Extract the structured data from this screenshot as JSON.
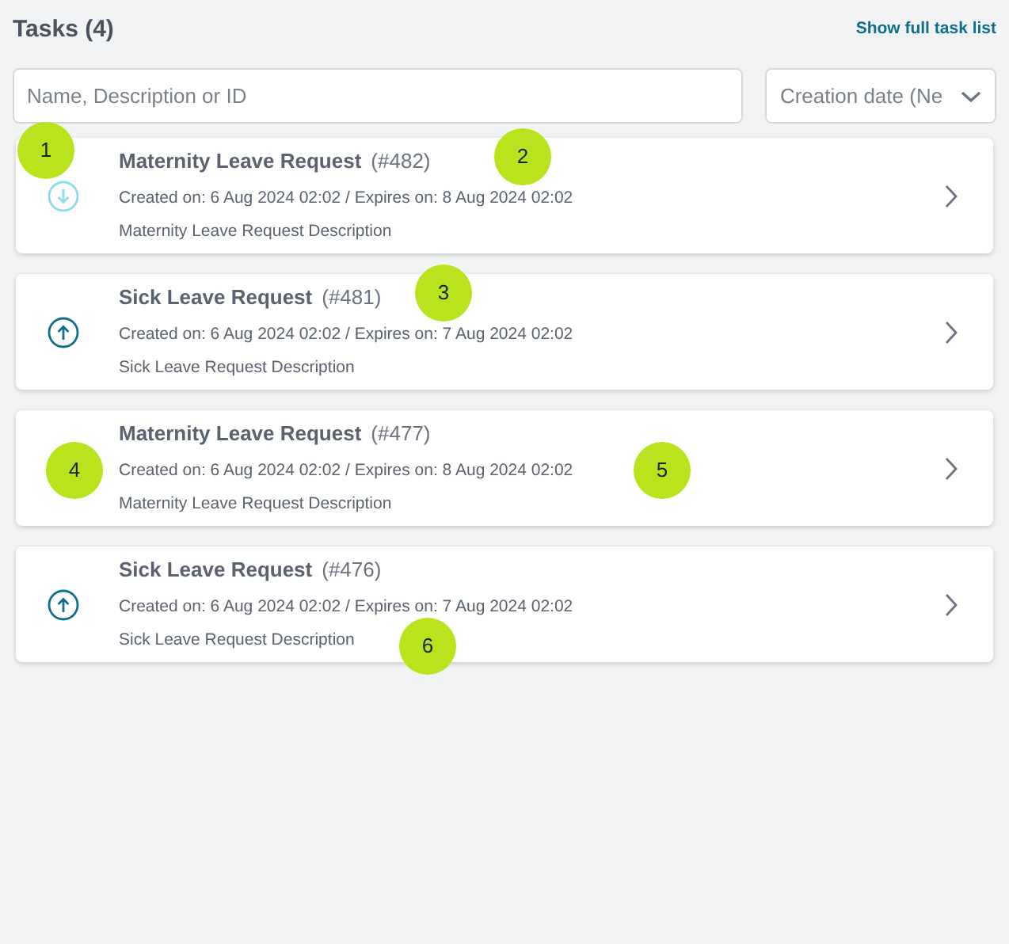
{
  "header": {
    "title": "Tasks (4)",
    "link": "Show full task list"
  },
  "search": {
    "placeholder": "Name, Description or ID"
  },
  "sort": {
    "value": "Creation date (Ne"
  },
  "tasks": [
    {
      "kind": "down",
      "title": "Maternity Leave Request",
      "id": "(#482)",
      "dates": "Created on: 6 Aug 2024 02:02 / Expires on: 8 Aug 2024 02:02",
      "description": "Maternity Leave Request Description"
    },
    {
      "kind": "up",
      "title": "Sick Leave Request",
      "id": "(#481)",
      "dates": "Created on: 6 Aug 2024 02:02 / Expires on: 7 Aug 2024 02:02",
      "description": "Sick Leave Request Description"
    },
    {
      "kind": "none",
      "title": "Maternity Leave Request",
      "id": "(#477)",
      "dates": "Created on: 6 Aug 2024 02:02 / Expires on: 8 Aug 2024 02:02",
      "description": "Maternity Leave Request Description"
    },
    {
      "kind": "up",
      "title": "Sick Leave Request",
      "id": "(#476)",
      "dates": "Created on: 6 Aug 2024 02:02 / Expires on: 7 Aug 2024 02:02",
      "description": "Sick Leave Request Description"
    }
  ],
  "annotations": [
    "1",
    "2",
    "3",
    "4",
    "5",
    "6"
  ]
}
